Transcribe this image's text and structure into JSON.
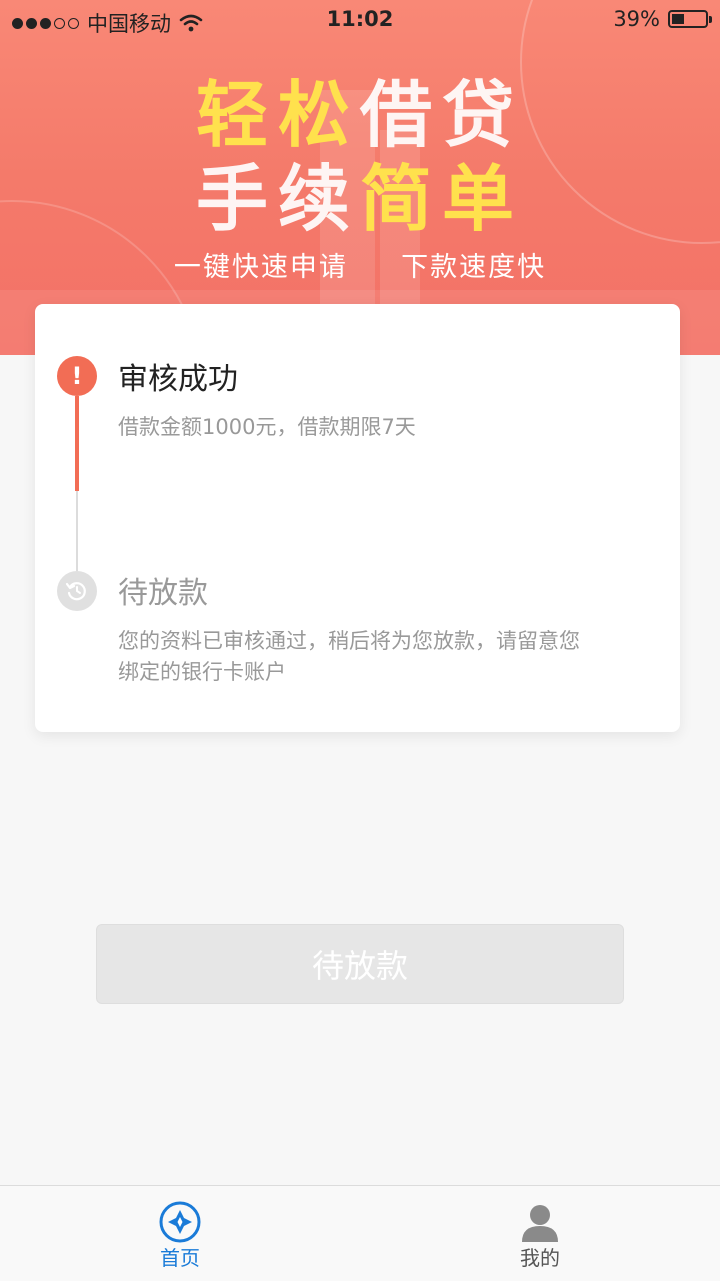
{
  "status_bar": {
    "carrier": "中国移动",
    "time": "11:02",
    "battery_percent": "39%",
    "battery_level": 0.39,
    "signal_bars_filled": 3,
    "signal_bars_total": 5,
    "wifi_icon": "wifi-icon"
  },
  "banner": {
    "headline_line1_part1": "轻松",
    "headline_line1_part2": "借贷",
    "headline_line2_part1": "手续",
    "headline_line2_part2": "简单",
    "subline_left": "一键快速申请",
    "subline_right": "下款速度快"
  },
  "steps": [
    {
      "title": "审核成功",
      "description": "借款金额1000元，借款期限7天",
      "state": "done",
      "icon": "exclamation-icon"
    },
    {
      "title": "待放款",
      "description": "您的资料已审核通过，稍后将为您放款，请留意您绑定的银行卡账户",
      "state": "pending",
      "icon": "refresh-clock-icon"
    }
  ],
  "action_button": {
    "label": "待放款",
    "enabled": false
  },
  "tabbar": {
    "items": [
      {
        "label": "首页",
        "icon": "home-diamond-icon",
        "active": true
      },
      {
        "label": "我的",
        "icon": "user-icon",
        "active": false
      }
    ]
  },
  "colors": {
    "accent": "#f26d55",
    "highlight": "#ffe14d",
    "tab_active": "#1a7bd8"
  }
}
